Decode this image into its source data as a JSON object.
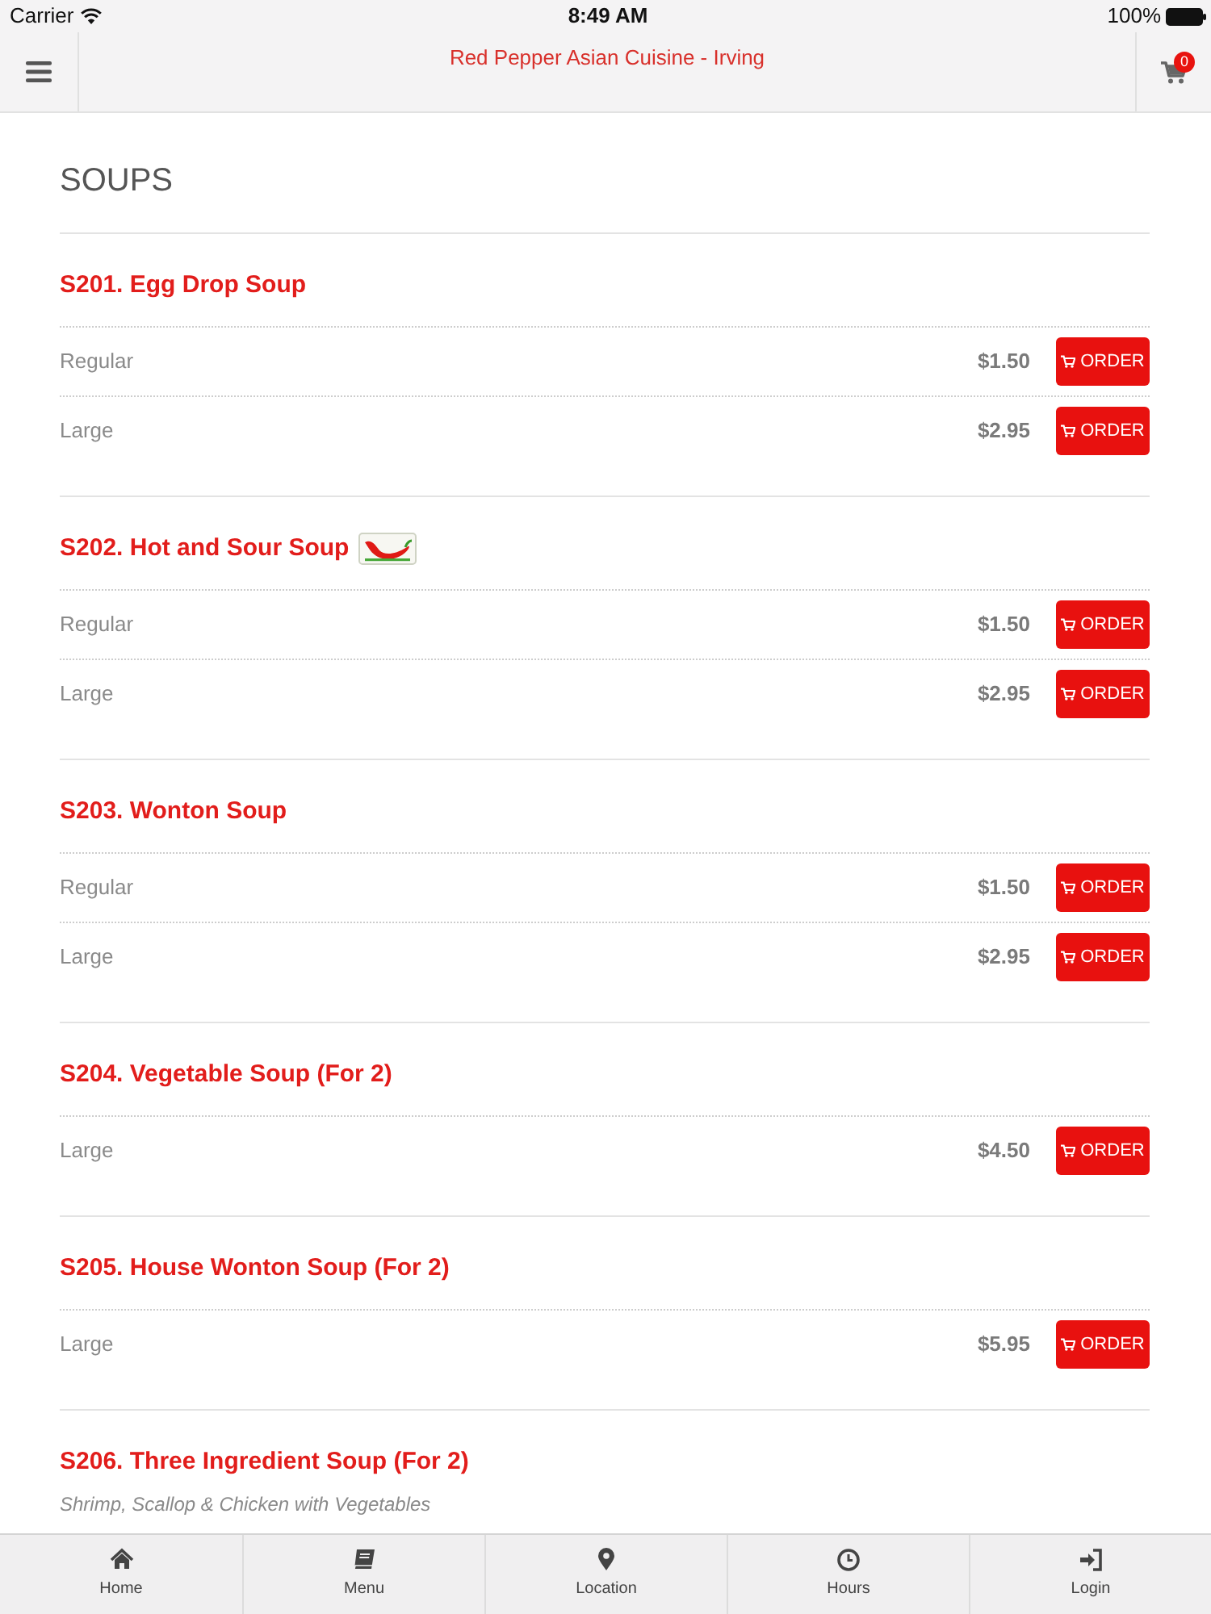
{
  "status_bar": {
    "carrier": "Carrier",
    "time": "8:49 AM",
    "battery": "100%"
  },
  "header": {
    "title": "Red Pepper Asian Cuisine - Irving",
    "cart_count": "0"
  },
  "section": {
    "title": "SOUPS"
  },
  "items": [
    {
      "name": "S201. Egg Drop Soup",
      "spicy": false,
      "sizes": [
        {
          "label": "Regular",
          "price": "$1.50",
          "button": "ORDER"
        },
        {
          "label": "Large",
          "price": "$2.95",
          "button": "ORDER"
        }
      ]
    },
    {
      "name": "S202. Hot and Sour Soup",
      "spicy": true,
      "sizes": [
        {
          "label": "Regular",
          "price": "$1.50",
          "button": "ORDER"
        },
        {
          "label": "Large",
          "price": "$2.95",
          "button": "ORDER"
        }
      ]
    },
    {
      "name": "S203. Wonton Soup",
      "spicy": false,
      "sizes": [
        {
          "label": "Regular",
          "price": "$1.50",
          "button": "ORDER"
        },
        {
          "label": "Large",
          "price": "$2.95",
          "button": "ORDER"
        }
      ]
    },
    {
      "name": "S204. Vegetable Soup (For 2)",
      "spicy": false,
      "sizes": [
        {
          "label": "Large",
          "price": "$4.50",
          "button": "ORDER"
        }
      ]
    },
    {
      "name": "S205. House Wonton Soup (For 2)",
      "spicy": false,
      "sizes": [
        {
          "label": "Large",
          "price": "$5.95",
          "button": "ORDER"
        }
      ]
    },
    {
      "name": "S206. Three Ingredient Soup (For 2)",
      "spicy": false,
      "description": "Shrimp, Scallop & Chicken with Vegetables"
    }
  ],
  "tab_bar": [
    {
      "label": "Home"
    },
    {
      "label": "Menu"
    },
    {
      "label": "Location"
    },
    {
      "label": "Hours"
    },
    {
      "label": "Login"
    }
  ]
}
